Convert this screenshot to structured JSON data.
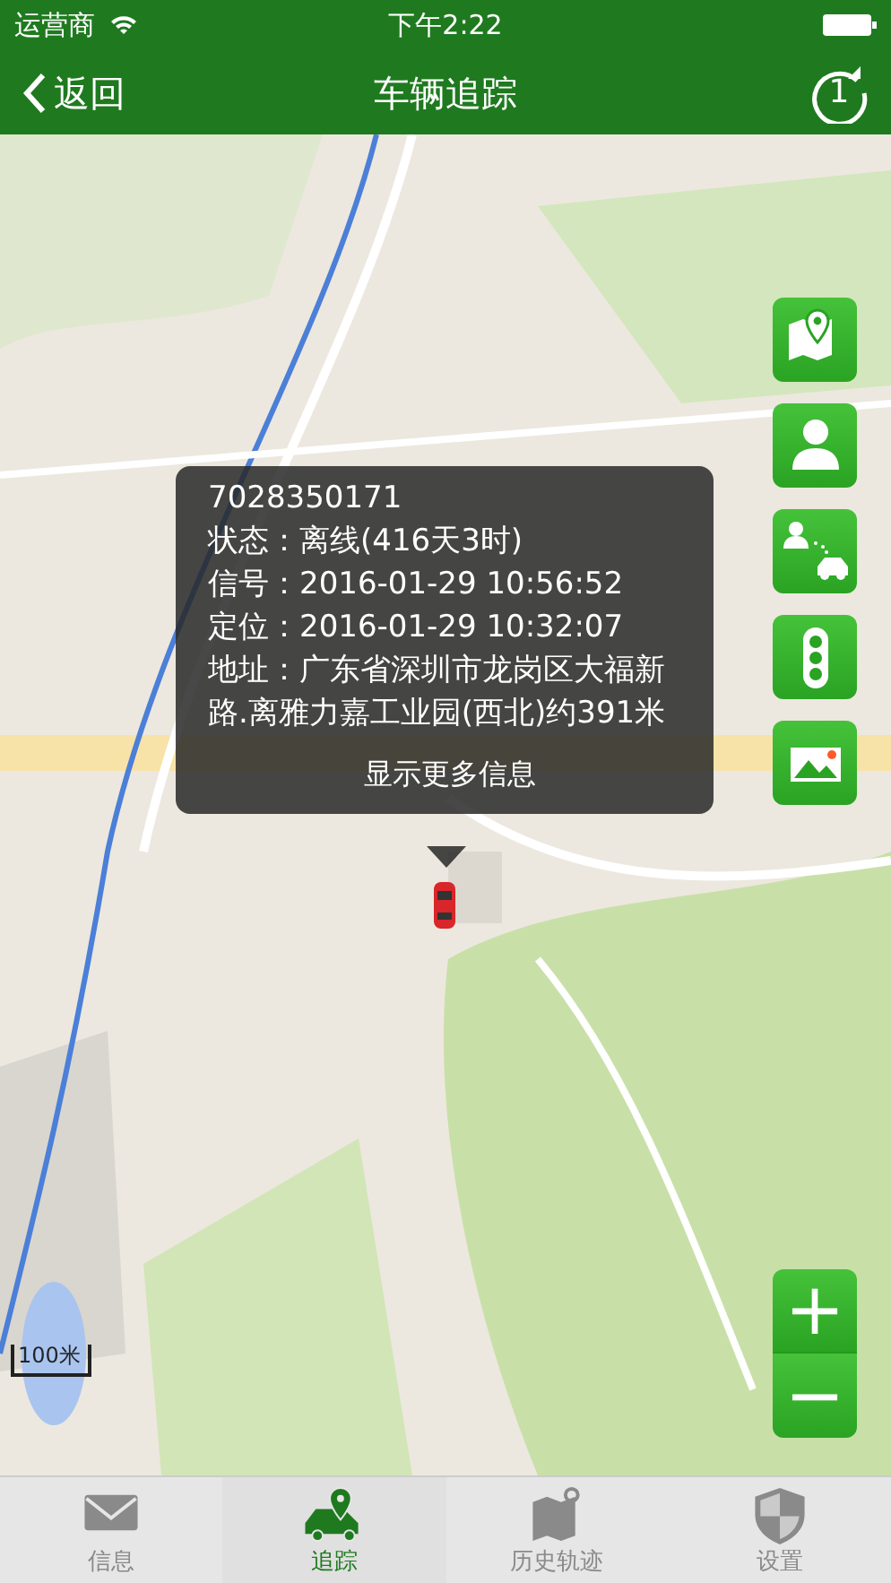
{
  "status_bar": {
    "carrier": "运营商",
    "time": "下午2:22"
  },
  "nav": {
    "back": "返回",
    "title": "车辆追踪",
    "refresh_count": "1"
  },
  "popup": {
    "lines": [
      "7028350171",
      "状态：离线(416天3时)",
      "信号：2016-01-29 10:56:52",
      "定位：2016-01-29 10:32:07",
      "地址：广东省深圳市龙岗区大福新路.离雅力嘉工业园(西北)约391米"
    ],
    "more": "显示更多信息"
  },
  "map_tools": [
    {
      "kind": "map"
    },
    {
      "kind": "person"
    },
    {
      "kind": "person-car"
    },
    {
      "kind": "traffic"
    },
    {
      "kind": "picture"
    }
  ],
  "zoom": {
    "in": "+",
    "out": "−"
  },
  "scale": "100米",
  "tabs": [
    {
      "label": "信息",
      "kind": "mail",
      "selected": false
    },
    {
      "label": "追踪",
      "kind": "car",
      "selected": true
    },
    {
      "label": "历史轨迹",
      "kind": "map",
      "selected": false
    },
    {
      "label": "设置",
      "kind": "shield",
      "selected": false
    }
  ]
}
